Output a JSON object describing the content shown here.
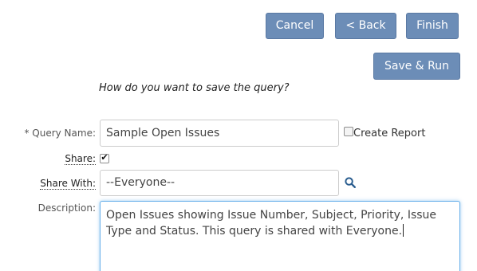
{
  "toolbar": {
    "cancel_label": "Cancel",
    "back_label": "< Back",
    "finish_label": "Finish",
    "save_run_label": "Save & Run"
  },
  "form": {
    "prompt": "How do you want to save the query?",
    "query_name_label": "* Query Name:",
    "query_name_value": "Sample Open Issues",
    "create_report_label": "Create Report",
    "create_report_checked": false,
    "share_label": "Share:",
    "share_checked": true,
    "share_with_label": "Share With:",
    "share_with_value": "--Everyone--",
    "description_label": "Description:",
    "description_value": "Open Issues showing Issue Number, Subject, Priority, Issue Type and Status. This query is shared with Everyone."
  },
  "icons": {
    "search": "search-icon",
    "check": "check-icon"
  },
  "colors": {
    "button_bg": "#6c8db7",
    "focus_border": "#66afe9",
    "search_icon": "#2a5d8f"
  }
}
